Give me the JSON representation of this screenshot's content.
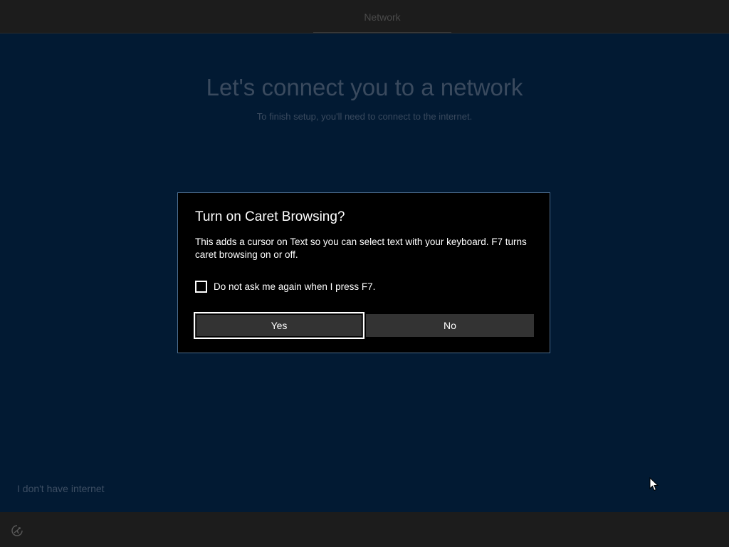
{
  "header": {
    "tab_label": "Network"
  },
  "main": {
    "heading": "Let's connect you to a network",
    "subheading": "To finish setup, you'll need to connect to the internet.",
    "no_internet_link": "I don't have internet"
  },
  "dialog": {
    "title": "Turn on Caret Browsing?",
    "body": "This adds a cursor on Text so you can select text with your keyboard. F7 turns caret browsing on or off.",
    "checkbox_label": "Do not ask me again when I press F7.",
    "checkbox_checked": false,
    "yes_label": "Yes",
    "no_label": "No"
  },
  "footer": {
    "accessibility_icon": "accessibility-icon"
  },
  "colors": {
    "background": "#021a33",
    "bar": "#1c1c1c",
    "dialog_background": "#000000",
    "dialog_border": "#4c6c8c",
    "button": "#333333"
  }
}
